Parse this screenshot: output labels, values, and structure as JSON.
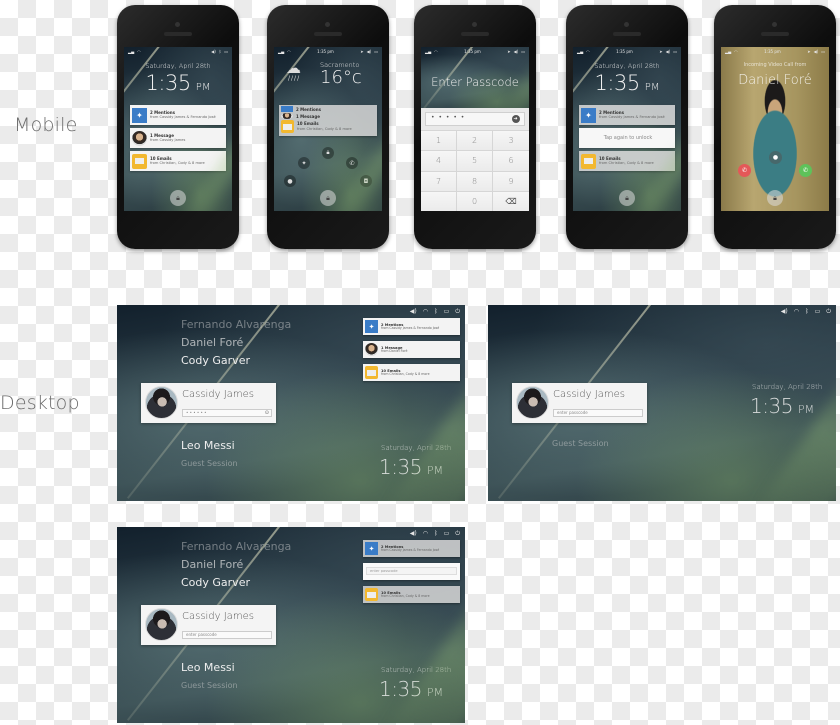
{
  "labels": {
    "mobile": "Mobile",
    "desktop": "Desktop"
  },
  "status": {
    "time": "1:35 pm"
  },
  "lock_date": "Saturday, April 28th",
  "lock_time": "1:35",
  "lock_ampm": "PM",
  "notifications": [
    {
      "icon": "twitter-icon",
      "title": "2 Mentions",
      "subtitle": "from Cassidy James & Fernando José"
    },
    {
      "icon": "avatar",
      "title": "1 Message",
      "subtitle": "from Cassidy James"
    },
    {
      "icon": "mail-icon",
      "title": "10 Emails",
      "subtitle": "from Christian, Cody & 8 more"
    }
  ],
  "desktop_notifications": [
    {
      "icon": "twitter-icon",
      "title": "2 Mentions",
      "subtitle": "from Cassidy James & Fernando José"
    },
    {
      "icon": "avatar",
      "title": "1 Message",
      "subtitle": "from Daniel Foré"
    },
    {
      "icon": "mail-icon",
      "title": "10 Emails",
      "subtitle": "from Christian, Cody & 8 more"
    }
  ],
  "weather": {
    "city": "Sacramento",
    "temp": "16°c",
    "condition": "rain-cloud-icon"
  },
  "quick_actions": [
    "twitter-icon",
    "lock-icon",
    "phone-icon",
    "chat-icon",
    "camera-icon"
  ],
  "passcode": {
    "title": "Enter Passcode",
    "value": "• • • • •",
    "keys": [
      "1",
      "2",
      "3",
      "4",
      "5",
      "6",
      "7",
      "8",
      "9",
      "",
      "0",
      "⌫"
    ]
  },
  "tap_unlock": "Tap again to unlock",
  "video_call": {
    "caption": "Incoming Video Call from",
    "caller": "Daniel Foré"
  },
  "greeter": {
    "users_above": [
      "Fernando Alvarenga",
      "Daniel Foré",
      "Cody Garver"
    ],
    "selected_user": "Cassidy James",
    "users_below": [
      "Leo Messi"
    ],
    "guest": "Guest Session",
    "password_masked": "• • • • • •",
    "password_placeholder": "enter passcode"
  },
  "desktop_topbar_icons": [
    "volume-icon",
    "wifi-icon",
    "bluetooth-icon",
    "battery-icon",
    "power-icon"
  ]
}
